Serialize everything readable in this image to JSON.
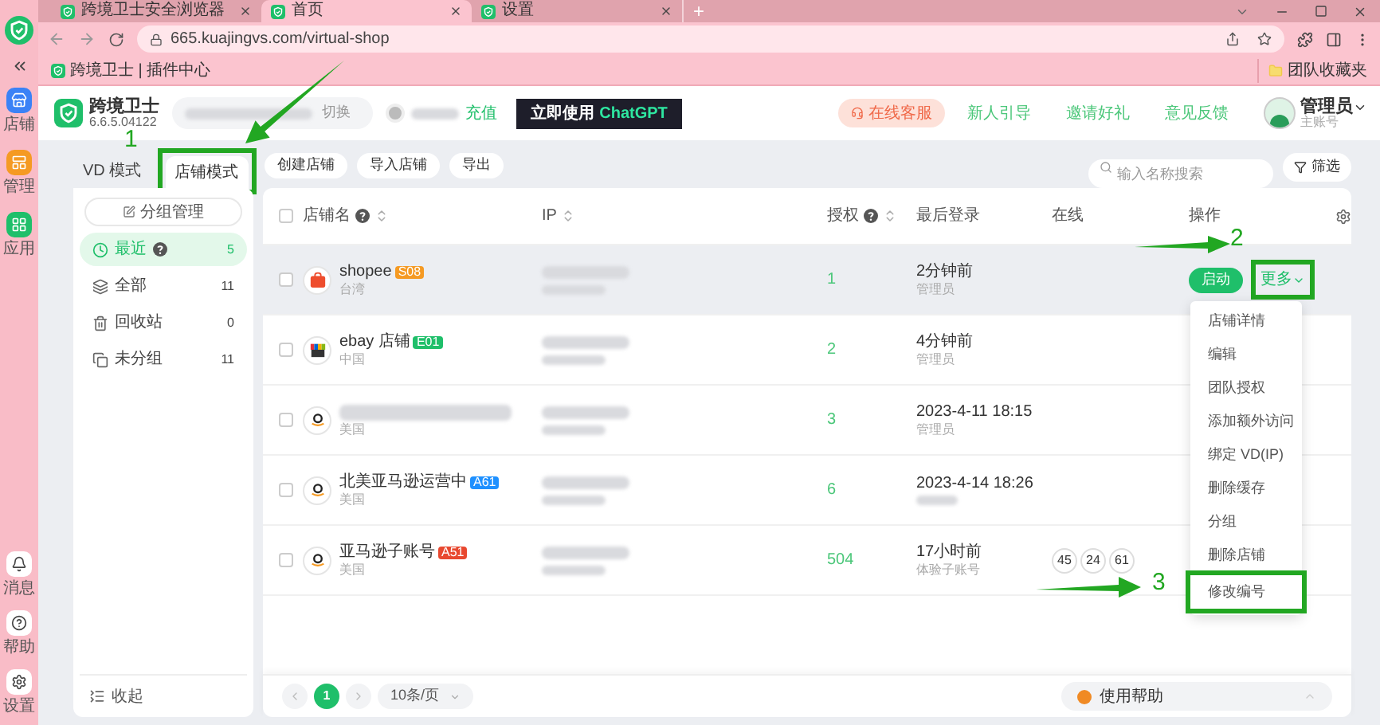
{
  "browser": {
    "tabs": [
      {
        "title": "跨境卫士安全浏览器",
        "selected": false
      },
      {
        "title": "首页",
        "selected": true
      },
      {
        "title": "设置",
        "selected": false
      }
    ],
    "new_tab": "+",
    "url": "665.kuajingvs.com/virtual-shop",
    "bookmarks": [
      {
        "label": "跨境卫士 | 插件中心"
      }
    ],
    "bookmark_folder": "团队收藏夹"
  },
  "rail": {
    "top": [
      {
        "label": "店铺"
      },
      {
        "label": "管理"
      },
      {
        "label": "应用"
      }
    ],
    "bottom": [
      {
        "label": "消息"
      },
      {
        "label": "帮助"
      },
      {
        "label": "设置"
      }
    ]
  },
  "header": {
    "app_name": "跨境卫士",
    "version": "6.6.5.04122",
    "switch": "切换",
    "recharge": "充值",
    "promo": {
      "prefix": "立即使用",
      "brand": "ChatGPT"
    },
    "links": [
      {
        "label": "在线客服",
        "kind": "pill"
      },
      {
        "label": "新人引导",
        "kind": "link"
      },
      {
        "label": "邀请好礼",
        "kind": "link"
      },
      {
        "label": "意见反馈",
        "kind": "link"
      }
    ],
    "user": {
      "name": "管理员",
      "role": "主账号"
    }
  },
  "modes": [
    {
      "label": "VD 模式",
      "selected": false
    },
    {
      "label": "店铺模式",
      "selected": true
    }
  ],
  "actions": [
    "创建店铺",
    "导入店铺",
    "导出"
  ],
  "search": {
    "placeholder": "输入名称搜索"
  },
  "filter": "筛选",
  "groups": {
    "manage": "分组管理",
    "collapse": "收起",
    "items": [
      {
        "label": "最近",
        "count": "5",
        "help": true,
        "selected": true
      },
      {
        "label": "全部",
        "count": "11",
        "help": false,
        "selected": false
      },
      {
        "label": "回收站",
        "count": "0",
        "help": false,
        "selected": false
      },
      {
        "label": "未分组",
        "count": "11",
        "help": false,
        "selected": false
      }
    ]
  },
  "table": {
    "select_all": {
      "checked": false
    },
    "columns": [
      {
        "label": "店铺名",
        "help": true,
        "sortable": true
      },
      {
        "label": "IP",
        "help": false,
        "sortable": true
      },
      {
        "label": "授权",
        "help": true,
        "sortable": true
      },
      {
        "label": "最后登录",
        "help": false,
        "sortable": false
      },
      {
        "label": "在线",
        "help": false,
        "sortable": false
      },
      {
        "label": "操作",
        "help": false,
        "sortable": false
      }
    ],
    "rows": [
      {
        "kind": "shopee",
        "checked": false,
        "name": "shopee",
        "tag": {
          "label": "S08",
          "color": "#f59a23"
        },
        "region": "台湾",
        "auth": "1",
        "last_login": "2分钟前",
        "login_by": "管理员",
        "hovered": true,
        "launch": "启动",
        "more": "更多"
      },
      {
        "kind": "ebay",
        "checked": false,
        "name": "ebay 店铺",
        "tag": {
          "label": "E01",
          "color": "#1fbf6a"
        },
        "region": "中国",
        "auth": "2",
        "last_login": "4分钟前",
        "login_by": "管理员",
        "hovered": false
      },
      {
        "kind": "amazon",
        "checked": false,
        "region": "美国",
        "auth": "3",
        "last_login": "2023-4-11 18:15",
        "login_by": "管理员",
        "hovered": false
      },
      {
        "kind": "amazon",
        "checked": false,
        "name": "北美亚马逊运营中",
        "tag": {
          "label": "A61",
          "color": "#1e90ff"
        },
        "region": "美国",
        "auth": "6",
        "last_login": "2023-4-14 18:26",
        "hovered": false
      },
      {
        "kind": "amazon",
        "checked": false,
        "name": "亚马逊子账号",
        "tag": {
          "label": "A51",
          "color": "#e8482f"
        },
        "region": "美国",
        "auth": "504",
        "last_login": "17小时前",
        "login_by": "体验子账号",
        "online": [
          "45",
          "24",
          "61"
        ],
        "hovered": false
      }
    ]
  },
  "menu": {
    "items": [
      "店铺详情",
      "编辑",
      "团队授权",
      "添加额外访问",
      "绑定 VD(IP)",
      "删除缓存",
      "分组",
      "删除店铺",
      "修改编号"
    ]
  },
  "pagination": {
    "pages": [
      {
        "label": "1",
        "selected": true
      }
    ],
    "page_size": "10条/页"
  },
  "help_button": "使用帮助",
  "annotations": [
    {
      "label": "1"
    },
    {
      "label": "2"
    },
    {
      "label": "3"
    }
  ]
}
